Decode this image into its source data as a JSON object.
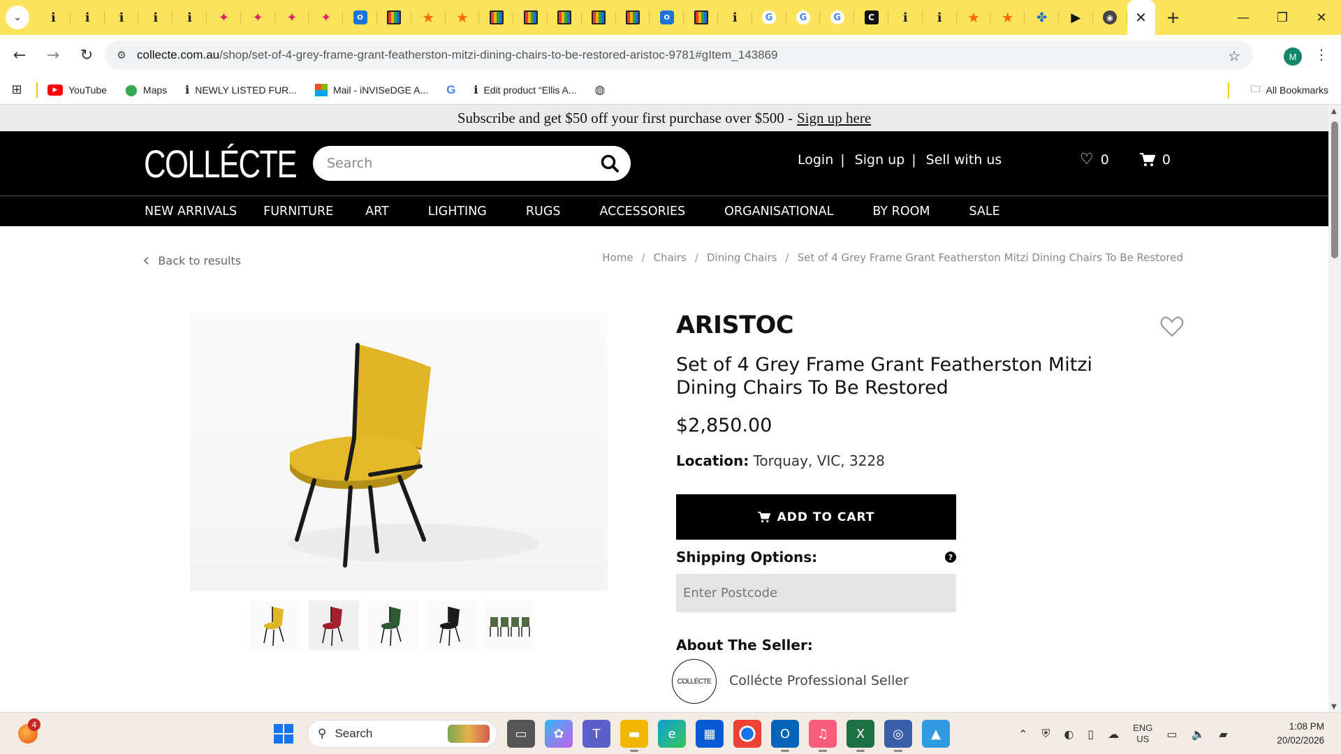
{
  "browser": {
    "tabs": [
      {
        "icon": "info-icon",
        "glyph": "i"
      },
      {
        "icon": "info-icon",
        "glyph": "i"
      },
      {
        "icon": "info-icon",
        "glyph": "i"
      },
      {
        "icon": "info-icon",
        "glyph": "i"
      },
      {
        "icon": "info-icon",
        "glyph": "i"
      },
      {
        "icon": "bird-icon",
        "glyph": "✦"
      },
      {
        "icon": "bird-icon",
        "glyph": "✦"
      },
      {
        "icon": "bird-icon",
        "glyph": "✦"
      },
      {
        "icon": "bird-icon",
        "glyph": "✦"
      },
      {
        "icon": "outlook-icon",
        "glyph": "O"
      },
      {
        "icon": "gumtree-icon",
        "glyph": ""
      },
      {
        "icon": "star-icon",
        "glyph": "★"
      },
      {
        "icon": "star-icon",
        "glyph": "★"
      },
      {
        "icon": "gumtree-icon",
        "glyph": ""
      },
      {
        "icon": "gumtree-icon",
        "glyph": ""
      },
      {
        "icon": "gumtree-icon",
        "glyph": ""
      },
      {
        "icon": "gumtree-icon",
        "glyph": ""
      },
      {
        "icon": "gumtree-icon",
        "glyph": ""
      },
      {
        "icon": "outlook-icon",
        "glyph": "O"
      },
      {
        "icon": "gumtree-icon",
        "glyph": ""
      },
      {
        "icon": "info-icon",
        "glyph": "i"
      },
      {
        "icon": "google-icon",
        "glyph": "G"
      },
      {
        "icon": "google-icon",
        "glyph": "G"
      },
      {
        "icon": "google-icon",
        "glyph": "G"
      },
      {
        "icon": "c-icon",
        "glyph": "C"
      },
      {
        "icon": "info-icon",
        "glyph": "i"
      },
      {
        "icon": "info-icon",
        "glyph": "i"
      },
      {
        "icon": "star-icon",
        "glyph": "★"
      },
      {
        "icon": "star-icon",
        "glyph": "★"
      },
      {
        "icon": "blue-app-icon",
        "glyph": "✤"
      },
      {
        "icon": "play-icon",
        "glyph": "▶"
      },
      {
        "icon": "chrome-icon",
        "glyph": "◉"
      }
    ],
    "active_tab_close": "✕",
    "new_tab": "+",
    "url_host": "collecte.com.au",
    "url_path": "/shop/set-of-4-grey-frame-grant-featherston-mitzi-dining-chairs-to-be-restored-aristoc-9781#gItem_143869",
    "profile_initial": "M",
    "bookmarks": [
      {
        "icon": "youtube-icon",
        "label": "YouTube"
      },
      {
        "icon": "maps-icon",
        "label": "Maps"
      },
      {
        "icon": "info-icon",
        "label": "NEWLY LISTED FUR..."
      },
      {
        "icon": "microsoft-icon",
        "label": "Mail - iNVISeDGE A..."
      },
      {
        "icon": "google-icon",
        "label": ""
      },
      {
        "icon": "info-icon",
        "label": "Edit product “Ellis A..."
      },
      {
        "icon": "globe-icon",
        "label": ""
      }
    ],
    "all_bookmarks": "All Bookmarks"
  },
  "site": {
    "promo_text": "Subscribe and get $50 off your first purchase over $500 -",
    "promo_link": "Sign up here",
    "logo": "COLLÉCTE",
    "search_placeholder": "Search",
    "account_links": [
      "Login",
      "Sign up",
      "Sell with us"
    ],
    "wishlist_count": "0",
    "cart_count": "0",
    "nav": [
      {
        "label": "NEW ARRIVALS",
        "width": 38
      },
      {
        "label": "FURNITURE",
        "width": 56
      },
      {
        "label": "ART",
        "width": 56
      },
      {
        "label": "LIGHTING",
        "width": 56
      },
      {
        "label": "RUGS",
        "width": 56
      },
      {
        "label": "ACCESSORIES",
        "width": 56
      },
      {
        "label": "ORGANISATIONAL",
        "width": 56
      },
      {
        "label": "BY ROOM",
        "width": 56
      },
      {
        "label": "SALE",
        "width": 0
      }
    ],
    "back_label": "Back to results",
    "breadcrumb": [
      "Home",
      "Chairs",
      "Dining Chairs",
      "Set of 4 Grey Frame Grant Featherston Mitzi Dining Chairs To Be Restored"
    ],
    "product": {
      "brand": "ARISTOC",
      "title": "Set of 4 Grey Frame Grant Featherston Mitzi Dining Chairs To Be Restored",
      "price": "$2,850.00",
      "location_label": "Location:",
      "location_value": "Torquay, VIC, 3228",
      "add_to_cart": "ADD TO CART",
      "shipping_label": "Shipping Options:",
      "postcode_placeholder": "Enter Postcode",
      "about_seller": "About The Seller:",
      "seller_logo": "COLLÉCTE",
      "seller_name": "Collécte Professional Seller"
    },
    "thumbnails": [
      {
        "name": "thumb-yellow-chair",
        "color": "#e2b526"
      },
      {
        "name": "thumb-red-chair",
        "color": "#a3212c"
      },
      {
        "name": "thumb-green-chair",
        "color": "#2d5a33"
      },
      {
        "name": "thumb-black-chair",
        "color": "#1c1c1c"
      },
      {
        "name": "thumb-four-chairs",
        "color": "#4f6a42"
      }
    ]
  },
  "taskbar": {
    "widget_badge": "4",
    "search_label": "Search",
    "lang_line1": "ENG",
    "lang_line2": "US",
    "time": "1:08 PM",
    "date": "20/02/2026"
  }
}
